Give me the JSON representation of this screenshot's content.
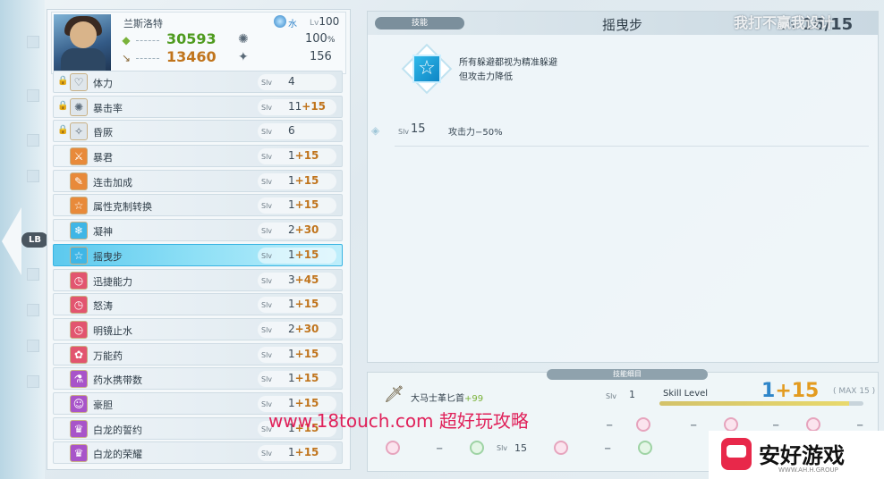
{
  "character": {
    "name": "兰斯洛特",
    "element": "水",
    "level": "Lv100",
    "level_prefix": "Lv",
    "level_num": "100",
    "hp": "30593",
    "atk": "13460",
    "crit": "100",
    "crit_unit": "%",
    "speed": "156"
  },
  "skills": [
    {
      "name": "体力",
      "locked": true,
      "level": "4",
      "plus": "",
      "icon": "heart",
      "color": "#dfe6eb"
    },
    {
      "name": "暴击率",
      "locked": true,
      "level": "11",
      "plus": "+15",
      "icon": "burst",
      "color": "#dfe6eb"
    },
    {
      "name": "昏厥",
      "locked": true,
      "level": "6",
      "plus": "",
      "icon": "stun",
      "color": "#dfe6eb"
    },
    {
      "name": "暴君",
      "locked": false,
      "level": "1",
      "plus": "+15",
      "icon": "axe",
      "color": "#e88a3a"
    },
    {
      "name": "连击加成",
      "locked": false,
      "level": "1",
      "plus": "+15",
      "icon": "sword",
      "color": "#e88a3a"
    },
    {
      "name": "属性克制转换",
      "locked": false,
      "level": "1",
      "plus": "+15",
      "icon": "star",
      "color": "#e88a3a"
    },
    {
      "name": "凝神",
      "locked": false,
      "level": "2",
      "plus": "+30",
      "icon": "snow",
      "color": "#3fb6e6"
    },
    {
      "name": "摇曳步",
      "locked": false,
      "level": "1",
      "plus": "+15",
      "icon": "star",
      "color": "#3fb6e6",
      "selected": true
    },
    {
      "name": "迅捷能力",
      "locked": false,
      "level": "3",
      "plus": "+45",
      "icon": "clock",
      "color": "#e2556f"
    },
    {
      "name": "怒涛",
      "locked": false,
      "level": "1",
      "plus": "+15",
      "icon": "clock",
      "color": "#e2556f"
    },
    {
      "name": "明镜止水",
      "locked": false,
      "level": "2",
      "plus": "+30",
      "icon": "clock",
      "color": "#e2556f"
    },
    {
      "name": "万能药",
      "locked": false,
      "level": "1",
      "plus": "+15",
      "icon": "pill",
      "color": "#e2556f"
    },
    {
      "name": "药水携带数",
      "locked": false,
      "level": "1",
      "plus": "+15",
      "icon": "potion",
      "color": "#a854c9"
    },
    {
      "name": "豪胆",
      "locked": false,
      "level": "1",
      "plus": "+15",
      "icon": "face",
      "color": "#a854c9"
    },
    {
      "name": "白龙的誓约",
      "locked": false,
      "level": "1",
      "plus": "+15",
      "icon": "dragon",
      "color": "#a854c9"
    },
    {
      "name": "白龙的荣耀",
      "locked": false,
      "level": "1",
      "plus": "+15",
      "icon": "dragon",
      "color": "#a854c9"
    }
  ],
  "slv_label": "Slv",
  "detail": {
    "tab": "技能",
    "title": "摇曳步",
    "slv_label": "Slv",
    "slv_value": "16/15",
    "desc1": "所有躲避都视为精准躲避",
    "desc2": "但攻击力降低",
    "level_row": {
      "slv": "Slv",
      "num": "15",
      "effect": "攻击力−50%"
    }
  },
  "breakdown": {
    "tab": "技能细目",
    "weapon": "大马士革匕首",
    "weapon_plus": "+99",
    "weapon_slv": "Slv",
    "weapon_lv": "1",
    "skill_level_label": "Skill Level",
    "skill_level": "1",
    "skill_plus": "+15",
    "max_label": "( MAX 15 )",
    "gauge_fraction": 0.93,
    "gem_slv": "Slv",
    "gem_val": "15",
    "dash": "−"
  },
  "lb_label": "LB",
  "watermark": "我打不赢我设计",
  "site_text": "www.18touch.com 超好玩攻略",
  "brand": {
    "name": "安好游戏",
    "sub": "WWW.AH.H.GROUP"
  },
  "colors": {
    "accent": "#2f86c9",
    "plus": "#c0741c",
    "selected": "#5cc9ee",
    "hp": "#4f9b1f",
    "atk": "#c0741c"
  }
}
